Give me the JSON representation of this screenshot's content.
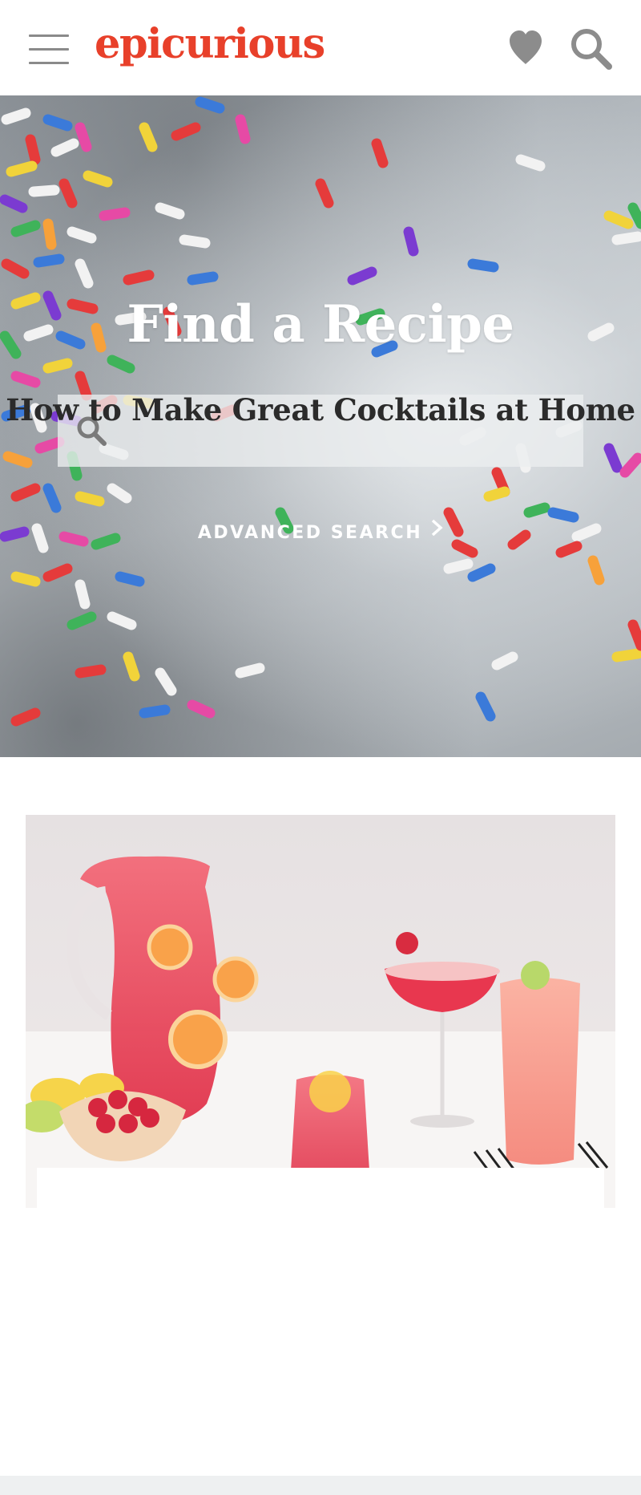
{
  "header": {
    "logo_text": "epicurious",
    "brand_color": "#e8402a",
    "menu_icon": "hamburger-menu-icon",
    "saved_icon": "heart-icon",
    "search_icon": "search-icon"
  },
  "hero": {
    "title": "Find a Recipe",
    "search_placeholder": "",
    "search_value": "",
    "advanced_search_label": "ADVANCED SEARCH",
    "advanced_icon": "chevron-right-icon"
  },
  "feature_card": {
    "title": "How to Make Great Cocktails at Home",
    "image": "pitcher-and-cocktails-photo"
  }
}
